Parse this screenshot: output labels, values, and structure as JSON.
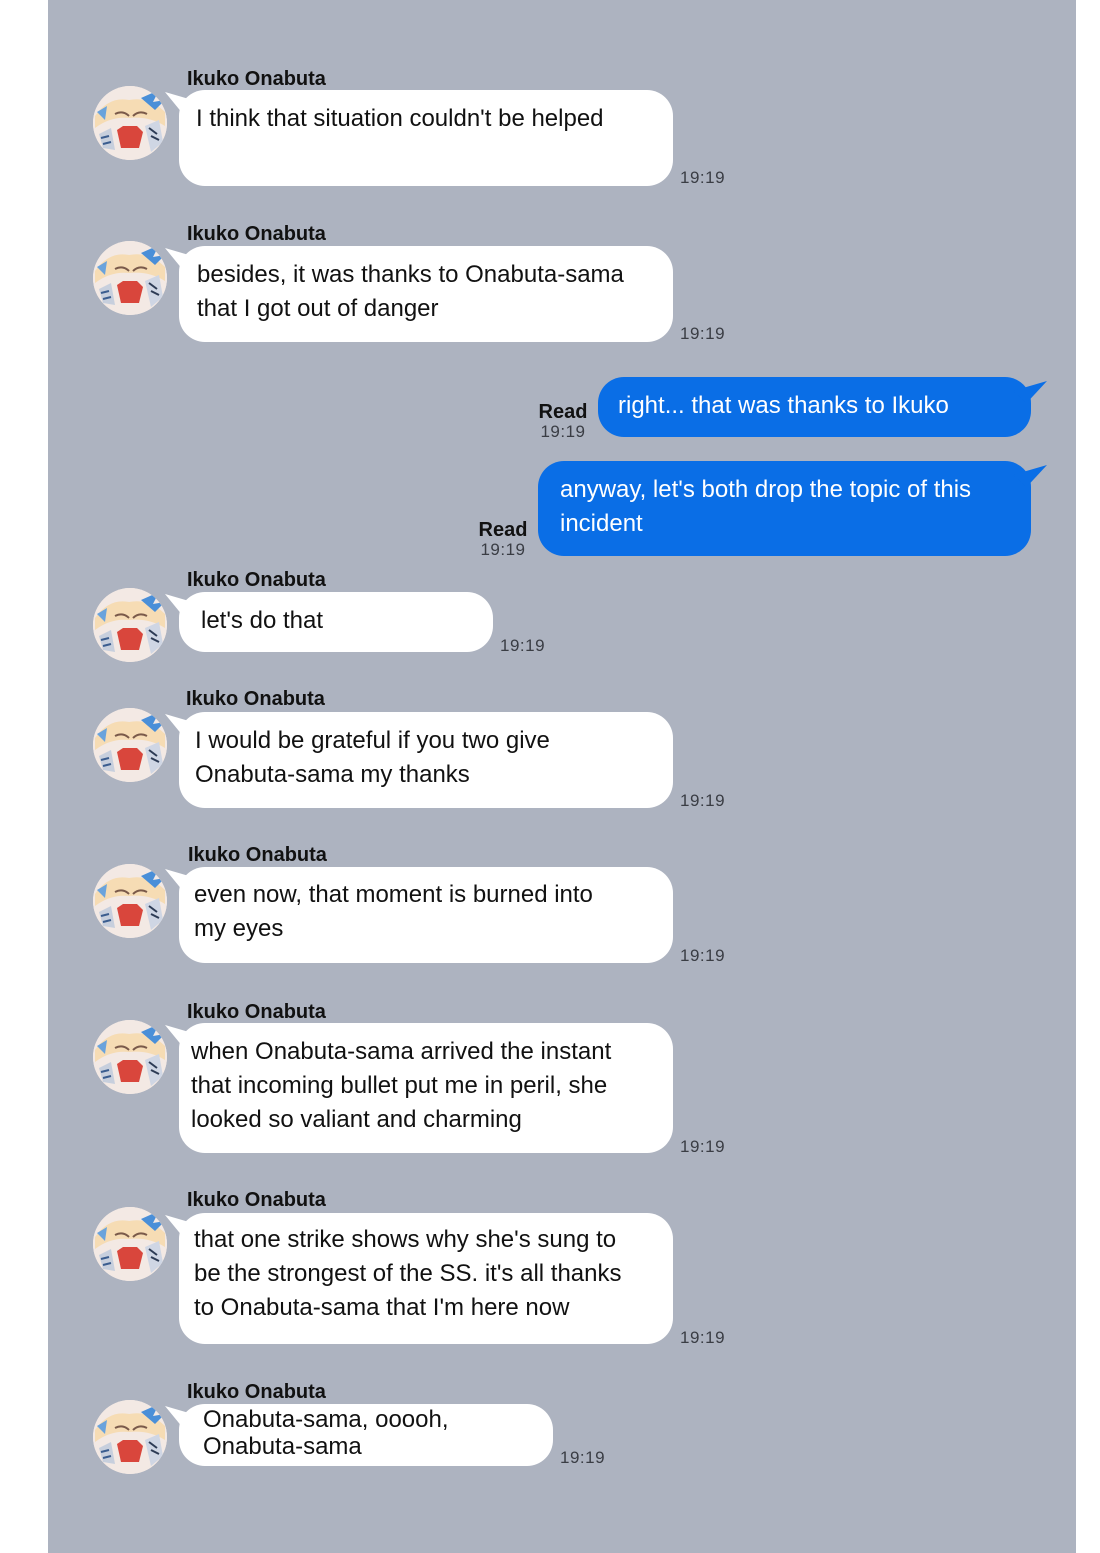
{
  "contact_name": "Ikuko Onabuta",
  "avatar_icon": "character-avatar",
  "colors": {
    "background": "#adb3c0",
    "incoming_bubble": "#ffffff",
    "outgoing_bubble": "#0a6ee6"
  },
  "messages": [
    {
      "sender": "Ikuko Onabuta",
      "lines": [
        "I think that situation couldn't be helped"
      ],
      "time": "19:19"
    },
    {
      "sender": "Ikuko Onabuta",
      "lines": [
        "besides, it was thanks to Onabuta-sama",
        "that I got out of danger"
      ],
      "time": "19:19"
    },
    {
      "lines": [
        "right... that was thanks to Ikuko"
      ],
      "status": "Read",
      "time": "19:19"
    },
    {
      "lines": [
        "anyway, let's both drop the topic of this",
        "incident"
      ],
      "status": "Read",
      "time": "19:19"
    },
    {
      "sender": "Ikuko Onabuta",
      "lines": [
        "let's do that"
      ],
      "time": "19:19"
    },
    {
      "sender": "Ikuko Onabuta",
      "lines": [
        "I would be grateful if you two give",
        "Onabuta-sama my thanks"
      ],
      "time": "19:19"
    },
    {
      "sender": "Ikuko Onabuta",
      "lines": [
        "even now, that moment is burned into",
        "my eyes"
      ],
      "time": "19:19"
    },
    {
      "sender": "Ikuko Onabuta",
      "lines": [
        "when Onabuta-sama arrived the instant",
        "that incoming bullet put me in peril, she",
        "looked so valiant and charming"
      ],
      "time": "19:19"
    },
    {
      "sender": "Ikuko Onabuta",
      "lines": [
        "that one strike shows why she's sung to",
        "be the strongest of the SS. it's all thanks",
        "to Onabuta-sama that I'm here now"
      ],
      "time": "19:19"
    },
    {
      "sender": "Ikuko Onabuta",
      "lines": [
        "Onabuta-sama, ooooh,",
        "Onabuta-sama"
      ],
      "time": "19:19"
    }
  ]
}
